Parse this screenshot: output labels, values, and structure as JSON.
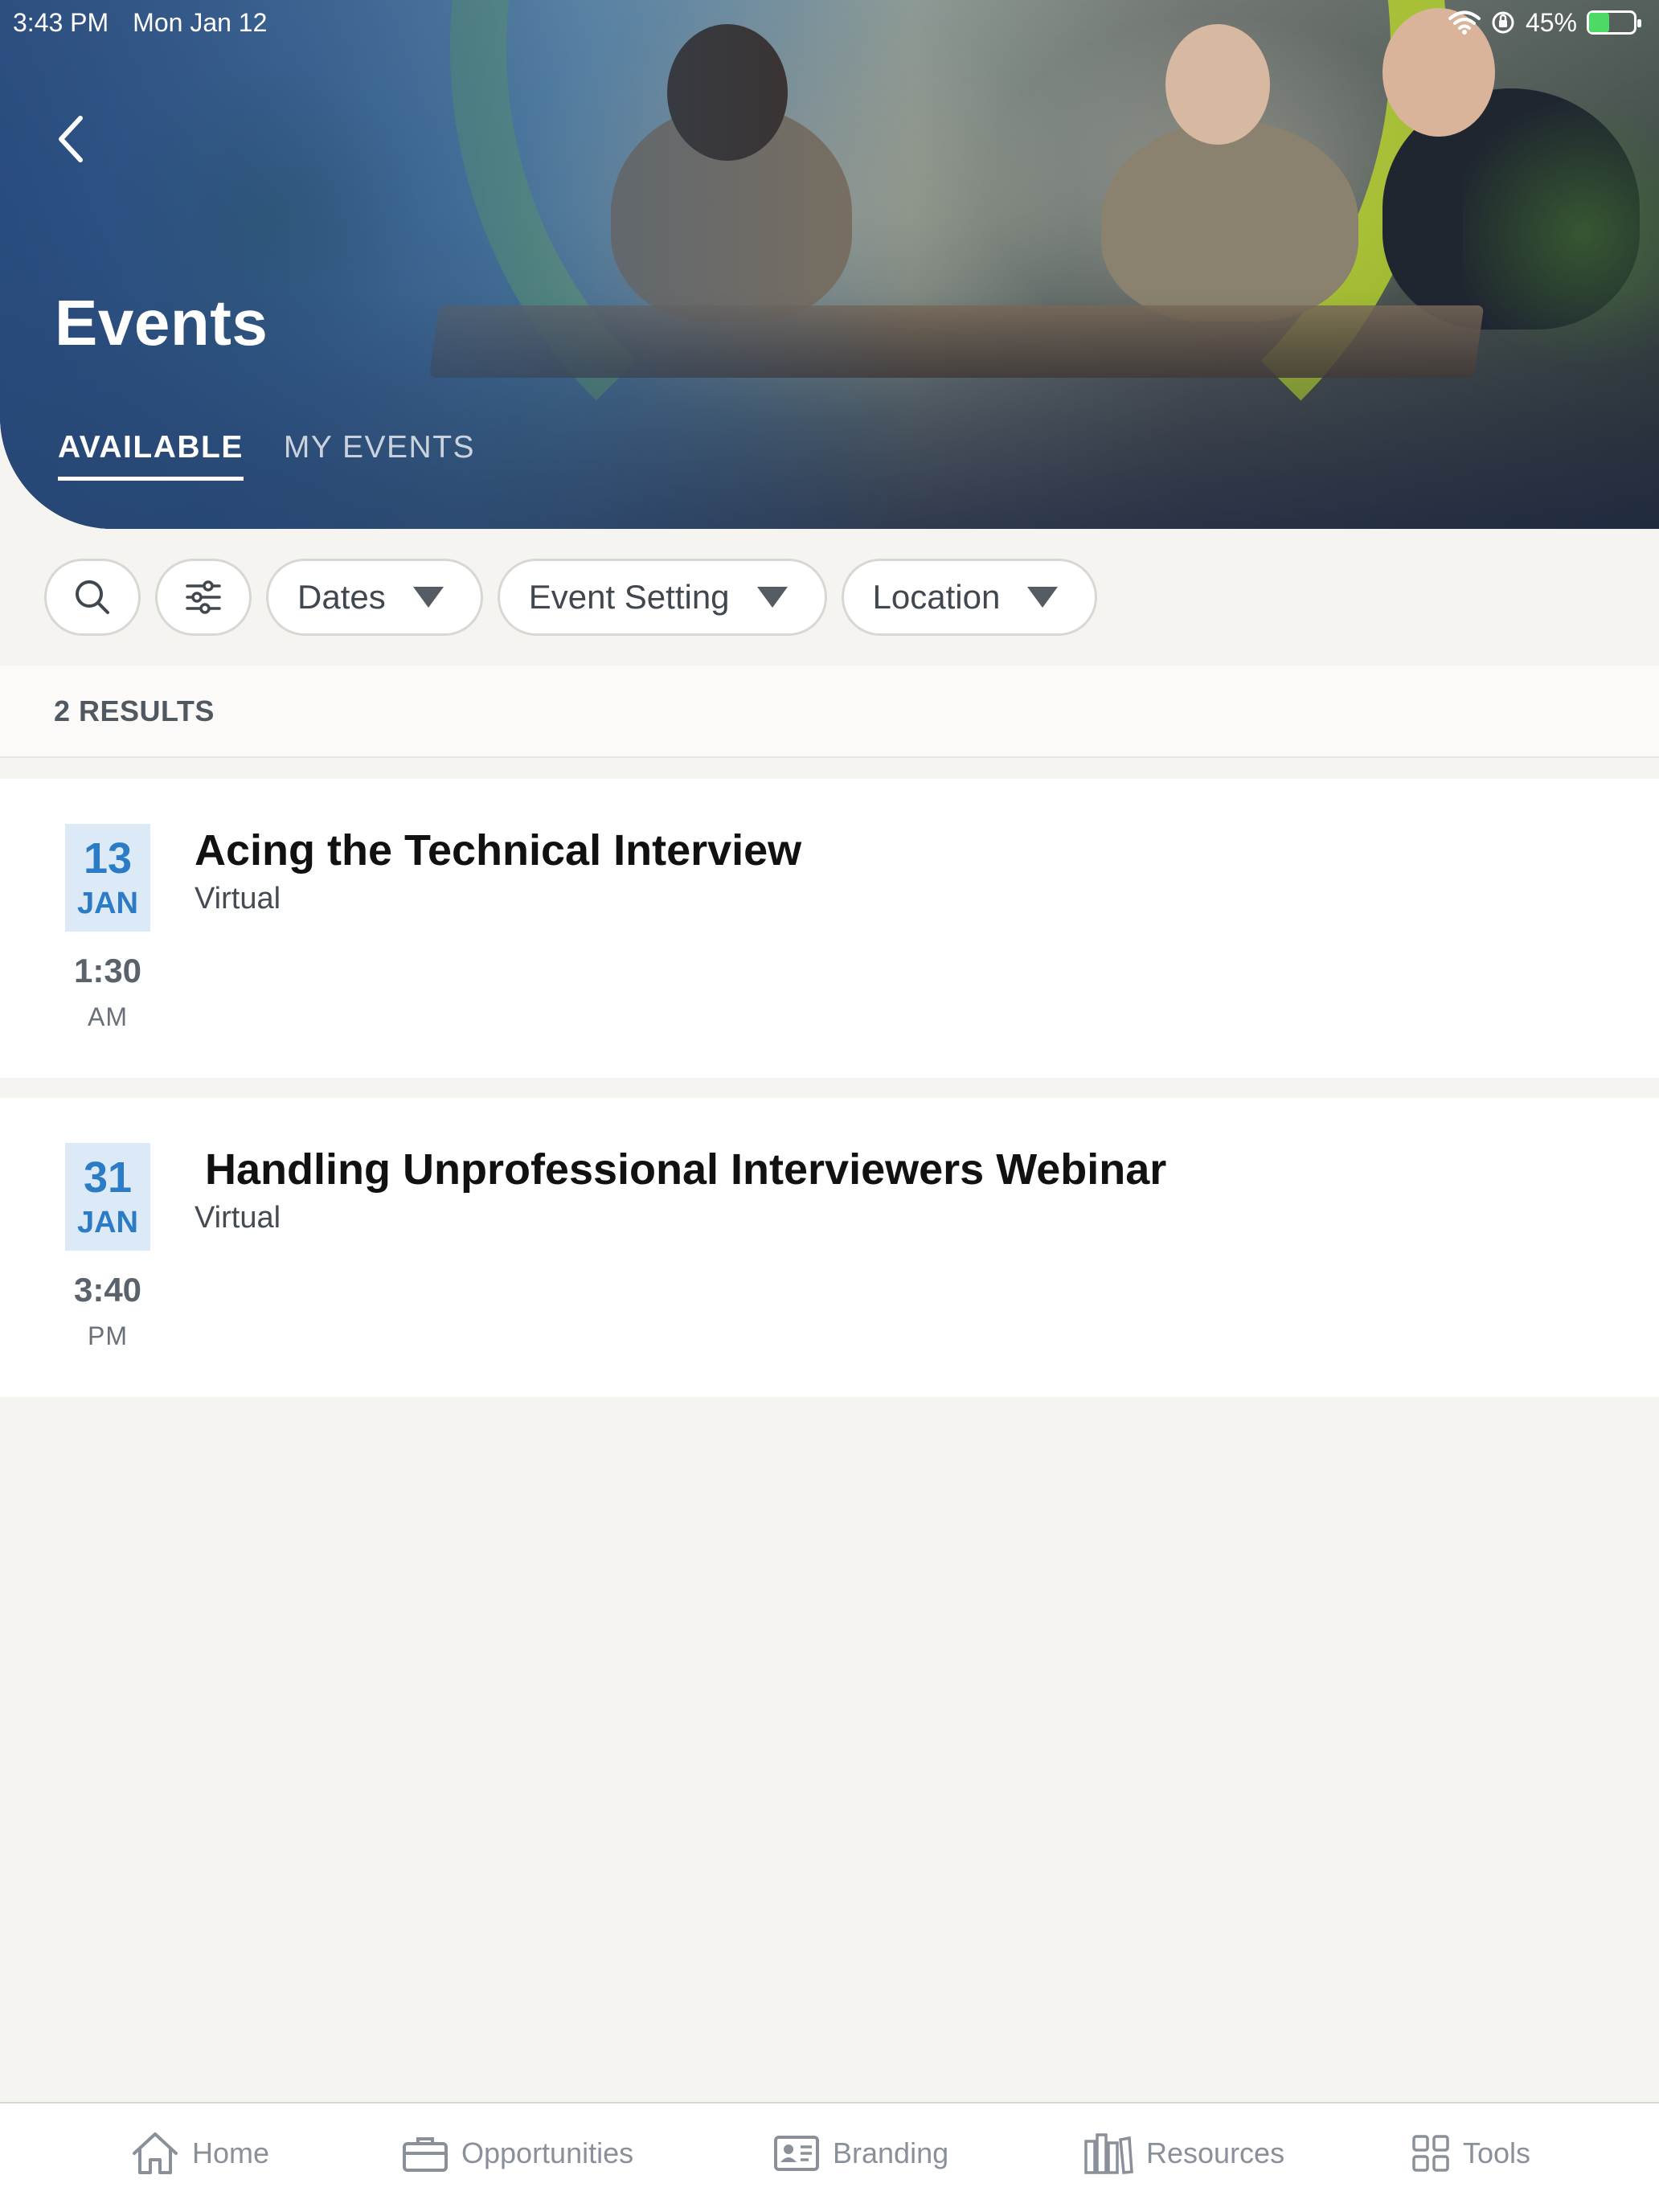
{
  "status_bar": {
    "time": "3:43 PM",
    "date": "Mon Jan 12",
    "battery": "45%",
    "battery_level": 0.45
  },
  "header": {
    "title": "Events",
    "tabs": [
      {
        "label": "AVAILABLE",
        "active": true
      },
      {
        "label": "MY EVENTS",
        "active": false
      }
    ]
  },
  "filters": {
    "dates_label": "Dates",
    "event_setting_label": "Event Setting",
    "location_label": "Location"
  },
  "results": {
    "count_label": "2 RESULTS",
    "events": [
      {
        "day": "13",
        "month": "JAN",
        "time": "1:30",
        "ampm": "AM",
        "title": "Acing the Technical Interview",
        "setting": "Virtual"
      },
      {
        "day": "31",
        "month": "JAN",
        "time": "3:40",
        "ampm": "PM",
        "title": "Handling Unprofessional Interviewers Webinar",
        "setting": "Virtual"
      }
    ]
  },
  "bottom_nav": [
    {
      "label": "Home",
      "icon": "home-icon"
    },
    {
      "label": "Opportunities",
      "icon": "briefcase-icon"
    },
    {
      "label": "Branding",
      "icon": "id-card-icon"
    },
    {
      "label": "Resources",
      "icon": "books-icon"
    },
    {
      "label": "Tools",
      "icon": "grid-icon"
    }
  ],
  "colors": {
    "accent": "#2b7bc7",
    "date_badge_bg": "#dce9f6",
    "background": "#f5f4f0"
  }
}
